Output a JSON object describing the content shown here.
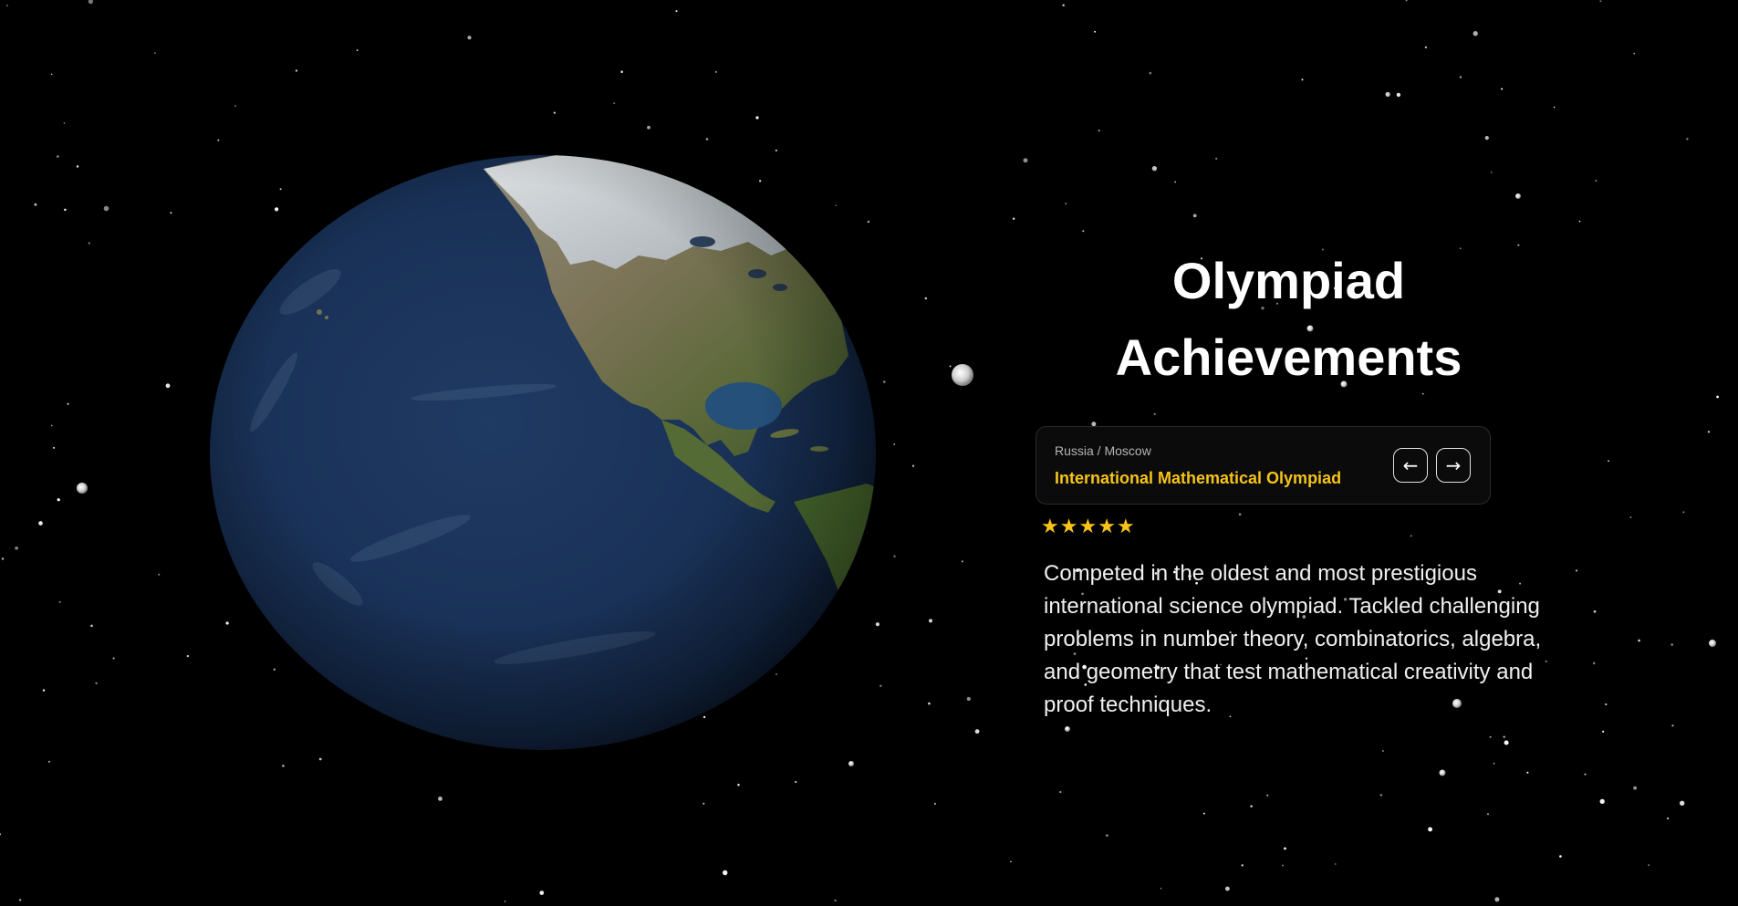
{
  "section": {
    "title_line1": "Olympiad",
    "title_line2": "Achievements"
  },
  "achievement": {
    "location": "Russia / Moscow",
    "name": "International Mathematical Olympiad",
    "rating": 5,
    "rating_max": 5,
    "description": "Competed in the oldest and most prestigious international science olympiad. Tackled challenging problems in number theory, combinatorics, algebra, and geometry that test mathematical creativity and proof techniques."
  },
  "navigation": {
    "prev_icon": "arrow-left-icon",
    "next_icon": "arrow-right-icon",
    "prev_symbol": "←",
    "next_symbol": "→"
  },
  "scene": {
    "background": "starfield",
    "globe": "earth-icon"
  },
  "colors": {
    "background": "#000000",
    "accent": "#f6c318",
    "text": "#ffffff",
    "muted_text": "#b4b4b4",
    "card_background": "#0b0b0b",
    "card_border": "#2b2b2b"
  }
}
